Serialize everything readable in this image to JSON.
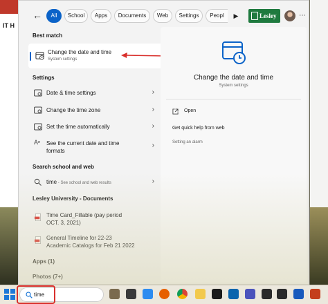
{
  "filters": {
    "back_icon": "back-arrow-icon",
    "tabs": [
      {
        "label": "All",
        "active": true
      },
      {
        "label": "School",
        "active": false
      },
      {
        "label": "Apps",
        "active": false
      },
      {
        "label": "Documents",
        "active": false
      },
      {
        "label": "Web",
        "active": false
      },
      {
        "label": "Settings",
        "active": false
      },
      {
        "label": "Peopl",
        "active": false
      }
    ],
    "logo_text": "Lesley",
    "accent_color": "#0b63c8"
  },
  "best_match": {
    "header": "Best match",
    "title": "Change the date and time",
    "subtitle": "System settings"
  },
  "settings": {
    "header": "Settings",
    "items": [
      {
        "label": "Date & time settings"
      },
      {
        "label": "Change the time zone"
      },
      {
        "label": "Set the time automatically"
      },
      {
        "label": "See the current date and time",
        "label2": "formats"
      }
    ]
  },
  "web": {
    "header": "Search school and web",
    "item_query": "time",
    "item_suffix": " - See school and web results"
  },
  "documents": {
    "header": "Lesley University - Documents",
    "items": [
      {
        "line1": "Time Card_Fillable (pay period",
        "line2": "OCT. 3, 2021)"
      },
      {
        "line1": "General Timeline for 22-23",
        "line2": "Academic Catalogs for Feb 21 2022"
      }
    ]
  },
  "apps_header": "Apps (1)",
  "photos_header": "Photos (7+)",
  "detail": {
    "title": "Change the date and time",
    "subtitle": "System settings",
    "actions": [
      {
        "label": "Open"
      },
      {
        "label": "Get quick help from web"
      },
      {
        "label": "Setting an alarm"
      }
    ]
  },
  "taskbar": {
    "search_value": "time",
    "background_app_label": "IT H"
  }
}
